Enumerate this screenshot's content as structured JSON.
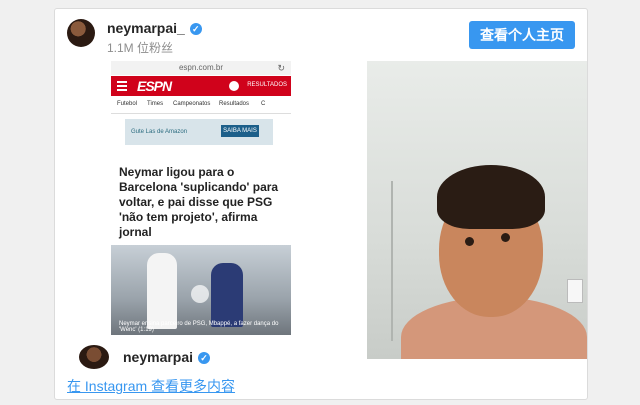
{
  "header": {
    "username": "neymarpai_",
    "followers": "1.1M 位粉丝",
    "profile_button": "查看个人主页"
  },
  "media": {
    "url": "espn.com.br",
    "refresh_icon": "↻",
    "logo": "ESPN",
    "results": "RESULTADOS",
    "nav": [
      "Futebol",
      "Times",
      "Campeonatos",
      "Resultados",
      "C"
    ],
    "ad_text": "Gute Las de Amazon",
    "ad_button": "SAIBA MAIS",
    "headline": "Neymar ligou para o Barcelona 'suplicando' para voltar, e pai disse que PSG 'não tem projeto', afirma jornal",
    "caption": "Neymar ensina parceiro de PSG, Mbappé, a fazer dança do 'Wenc' (1:19)"
  },
  "overlay": {
    "username": "neymarpai"
  },
  "footer": {
    "link": "在 Instagram 查看更多内容"
  },
  "colors": {
    "accent": "#3897f0",
    "espn_red": "#d0021b"
  }
}
